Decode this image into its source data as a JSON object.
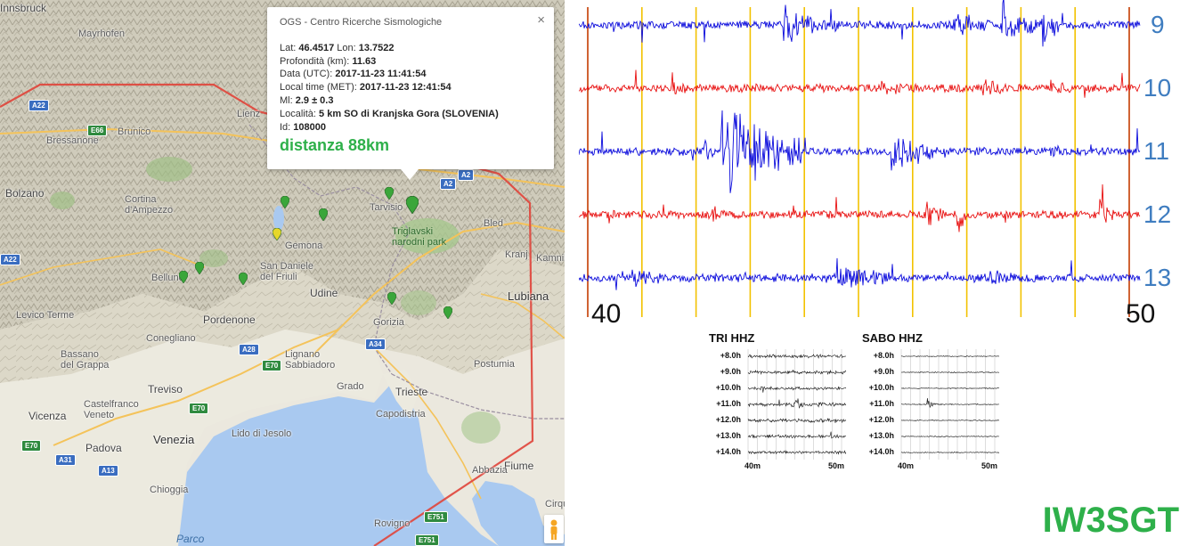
{
  "map": {
    "places": [
      {
        "name": "Innsbruck",
        "cls": "mid"
      },
      {
        "name": "Mayrhofen",
        "cls": ""
      },
      {
        "name": "Lienz",
        "cls": ""
      },
      {
        "name": "Bressanone",
        "cls": ""
      },
      {
        "name": "Brunico",
        "cls": ""
      },
      {
        "name": "Bolzano",
        "cls": "mid"
      },
      {
        "name": "Cortina\nd'Ampezzo",
        "cls": ""
      },
      {
        "name": "Belluno",
        "cls": ""
      },
      {
        "name": "Levico Terme",
        "cls": ""
      },
      {
        "name": "Pordenone",
        "cls": "mid"
      },
      {
        "name": "Conegliano",
        "cls": ""
      },
      {
        "name": "Bassano\ndel Grappa",
        "cls": ""
      },
      {
        "name": "Treviso",
        "cls": "mid"
      },
      {
        "name": "Castelfranco\nVeneto",
        "cls": ""
      },
      {
        "name": "Vicenza",
        "cls": "mid"
      },
      {
        "name": "Padova",
        "cls": "mid"
      },
      {
        "name": "Venezia",
        "cls": "big"
      },
      {
        "name": "Chioggia",
        "cls": ""
      },
      {
        "name": "Lido di Jesolo",
        "cls": ""
      },
      {
        "name": "Lignano\nSabbiadoro",
        "cls": ""
      },
      {
        "name": "Grado",
        "cls": ""
      },
      {
        "name": "Udine",
        "cls": "mid"
      },
      {
        "name": "San Daniele\ndel Friuli",
        "cls": ""
      },
      {
        "name": "Gemona",
        "cls": ""
      },
      {
        "name": "Tarvisio",
        "cls": ""
      },
      {
        "name": "Gorizia",
        "cls": ""
      },
      {
        "name": "Trieste",
        "cls": "mid"
      },
      {
        "name": "Capodistria",
        "cls": ""
      },
      {
        "name": "Postumia",
        "cls": ""
      },
      {
        "name": "Lubiana",
        "cls": "big"
      },
      {
        "name": "Kranj",
        "cls": ""
      },
      {
        "name": "Bled",
        "cls": ""
      },
      {
        "name": "Kamnik",
        "cls": ""
      },
      {
        "name": "Fiume",
        "cls": "mid"
      },
      {
        "name": "Abbazia",
        "cls": ""
      },
      {
        "name": "Rovigno",
        "cls": ""
      },
      {
        "name": "Cirque",
        "cls": ""
      }
    ],
    "park_label": "Triglavski\nnarodni park",
    "water_label": "Parco",
    "shields": [
      "A22",
      "E66",
      "A2",
      "A2",
      "A22",
      "A28",
      "E70",
      "A34",
      "E70",
      "A31",
      "A13",
      "E70",
      "E751",
      "E751"
    ],
    "popup": {
      "title": "OGS - Centro Ricerche Sismologiche",
      "close_glyph": "×",
      "lat_label": "Lat:",
      "lat": "46.4517",
      "lon_label": "Lon:",
      "lon": "13.7522",
      "depth_label": "Profondità (km):",
      "depth": "11.63",
      "date_utc_label": "Data (UTC):",
      "date_utc": "2017-11-23 11:41:54",
      "local_label": "Local time (MET):",
      "local": "2017-11-23 12:41:54",
      "ml_label": "Ml:",
      "ml": "2.9 ± 0.3",
      "loc_label": "Località:",
      "loc": "5 km SO di Kranjska Gora (SLOVENIA)",
      "id_label": "Id:",
      "id": "108000",
      "distance": "distanza 88km"
    },
    "route_color": "#e0443a",
    "marker_color": "#3aa63a",
    "event_marker_color": "#e6d72a"
  },
  "seismogram": {
    "traces": [
      {
        "num": "9",
        "color": "#0a0adc"
      },
      {
        "num": "10",
        "color": "#e81010"
      },
      {
        "num": "11",
        "color": "#0a0adc"
      },
      {
        "num": "12",
        "color": "#e81010"
      },
      {
        "num": "13",
        "color": "#0a0adc"
      }
    ],
    "time_start": "40",
    "time_end": "50",
    "minute_line_color": "#f2c200",
    "edge_line_color": "#c43c00"
  },
  "helicorders": [
    {
      "title": "TRI HHZ",
      "rows": [
        "+8.0h",
        "+9.0h",
        "+10.0h",
        "+11.0h",
        "+12.0h",
        "+13.0h",
        "+14.0h"
      ],
      "xlabels": [
        "40m",
        "50m"
      ]
    },
    {
      "title": "SABO HHZ",
      "rows": [
        "+8.0h",
        "+9.0h",
        "+10.0h",
        "+11.0h",
        "+12.0h",
        "+13.0h",
        "+14.0h"
      ],
      "xlabels": [
        "40m",
        "50m"
      ]
    }
  ],
  "callsign": "IW3SGT"
}
